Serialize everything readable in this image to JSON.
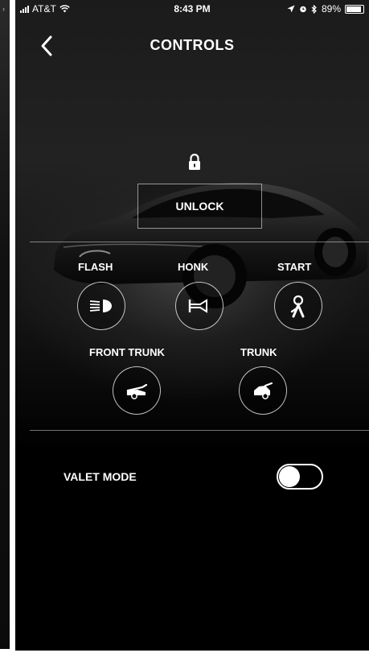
{
  "status_bar": {
    "carrier": "AT&T",
    "time": "8:43 PM",
    "battery": "89%",
    "battery_level": 0.89,
    "icons": [
      "signal-icon",
      "wifi-icon",
      "location-icon",
      "alarm-icon",
      "bluetooth-icon",
      "battery-icon"
    ]
  },
  "header": {
    "back_icon": "chevron-left-icon",
    "title": "CONTROLS"
  },
  "lock": {
    "icon": "padlock-icon",
    "unlock_label": "UNLOCK"
  },
  "controls": {
    "flash": {
      "label": "FLASH",
      "icon": "headlight-icon"
    },
    "honk": {
      "label": "HONK",
      "icon": "horn-icon"
    },
    "start": {
      "label": "START",
      "icon": "key-fob-icon"
    },
    "front_trunk": {
      "label": "FRONT TRUNK",
      "icon": "front-trunk-icon"
    },
    "trunk": {
      "label": "TRUNK",
      "icon": "rear-trunk-icon"
    }
  },
  "valet": {
    "label": "VALET MODE",
    "enabled": false
  },
  "colors": {
    "background": "#000000",
    "foreground": "#ffffff"
  }
}
